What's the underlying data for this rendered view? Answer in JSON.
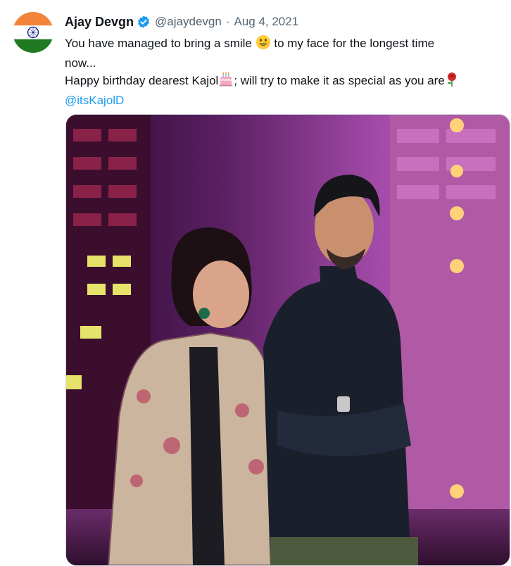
{
  "tweet": {
    "author_name": "Ajay Devgn",
    "verified_icon": "verified-badge-icon",
    "handle": "@ajaydevgn",
    "separator": "·",
    "date": "Aug 4, 2021",
    "text_line1": "You have managed to bring a smile",
    "text_line1_tail": " to my face for the longest time",
    "text_line2": "now...",
    "text_line3": "Happy birthday dearest Kajol",
    "text_line3_tail": "; will try to make it as special as you are",
    "mention": "@itsKajolD",
    "emojis": [
      "smiley-face-icon",
      "birthday-cake-icon",
      "red-rose-icon"
    ],
    "avatar": "indian-flag-avatar",
    "media": "photo of two people on a neon-lit stage"
  },
  "colors": {
    "text": "#0f1419",
    "secondary": "#536471",
    "link": "#1d9bf0",
    "verified": "#1d9bf0",
    "saffron": "#ff9933",
    "green": "#138808",
    "chakra": "#000080"
  }
}
